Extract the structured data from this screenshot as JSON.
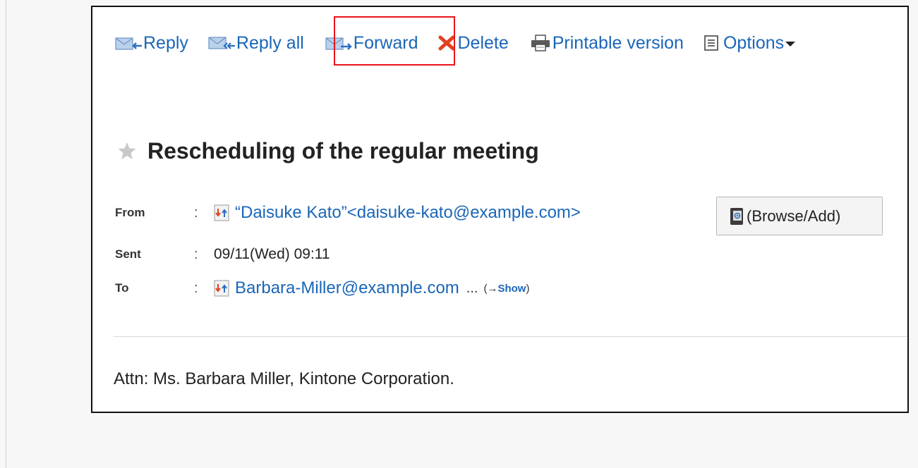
{
  "toolbar": {
    "reply": "Reply",
    "reply_all": "Reply all",
    "forward": "Forward",
    "delete": "Delete",
    "printable": "Printable version",
    "options": "Options"
  },
  "message": {
    "subject": "Rescheduling of the regular meeting",
    "from_label": "From",
    "sent_label": "Sent",
    "to_label": "To",
    "colon": ":",
    "from_value": "“Daisuke Kato”<daisuke-kato@example.com>",
    "sent_value": "09/11(Wed) 09:11",
    "to_value": "Barbara-Miller@example.com",
    "to_more": "...",
    "show_prefix": "(→",
    "show_label": "Show",
    "show_suffix": ")",
    "browse_add": "(Browse/Add)",
    "body": "Attn: Ms. Barbara Miller, Kintone Corporation."
  },
  "colors": {
    "link": "#1a66b8",
    "highlight": "#e8141b",
    "delete_icon": "#e2401e"
  },
  "icons": [
    "reply-icon",
    "reply-all-icon",
    "forward-icon",
    "delete-icon",
    "printer-icon",
    "options-menu-icon",
    "chevron-down-icon",
    "star-icon",
    "person-card-icon",
    "address-book-icon"
  ]
}
